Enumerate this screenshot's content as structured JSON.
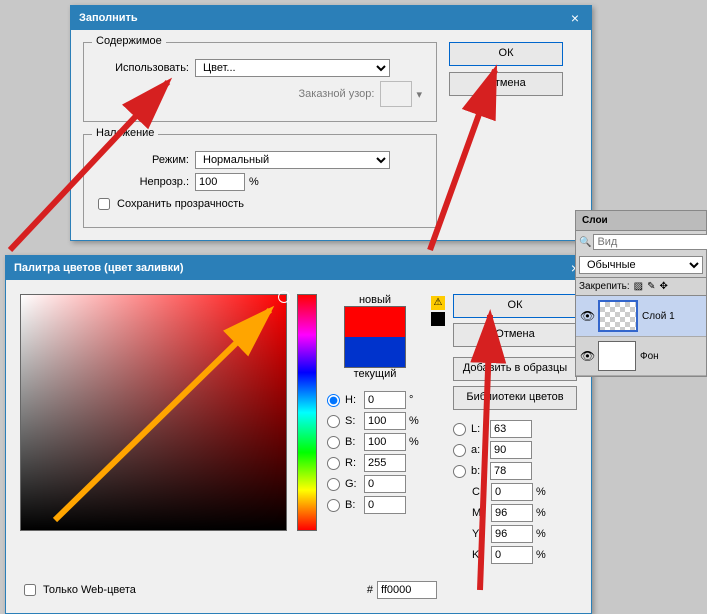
{
  "fill_dialog": {
    "title": "Заполнить",
    "content_legend": "Содержимое",
    "use_label": "Использовать:",
    "use_value": "Цвет...",
    "custom_pattern_label": "Заказной узор:",
    "overlay_legend": "Наложение",
    "mode_label": "Режим:",
    "mode_value": "Нормальный",
    "opacity_label": "Непрозр.:",
    "opacity_value": "100",
    "opacity_unit": "%",
    "preserve_trans": "Сохранить прозрачность",
    "ok": "ОК",
    "cancel": "Отмена"
  },
  "picker": {
    "title": "Палитра цветов (цвет заливки)",
    "new": "новый",
    "current": "текущий",
    "ok": "ОК",
    "cancel": "Отмена",
    "add_swatch": "Добавить в образцы",
    "libraries": "Библиотеки цветов",
    "H": "0",
    "S": "100",
    "Bv": "100",
    "R": "255",
    "G": "0",
    "Bb": "0",
    "L": "63",
    "a": "90",
    "bL": "78",
    "C": "0",
    "M": "96",
    "Y": "96",
    "K": "0",
    "hex_label": "#",
    "hex": "ff0000",
    "web_only": "Только Web-цвета",
    "deg": "°",
    "pct": "%"
  },
  "layers_panel": {
    "tab": "Слои",
    "search_placeholder": "Вид",
    "blend": "Обычные",
    "lock_label": "Закрепить:",
    "layer1": "Слой 1",
    "bg": "Фон"
  }
}
